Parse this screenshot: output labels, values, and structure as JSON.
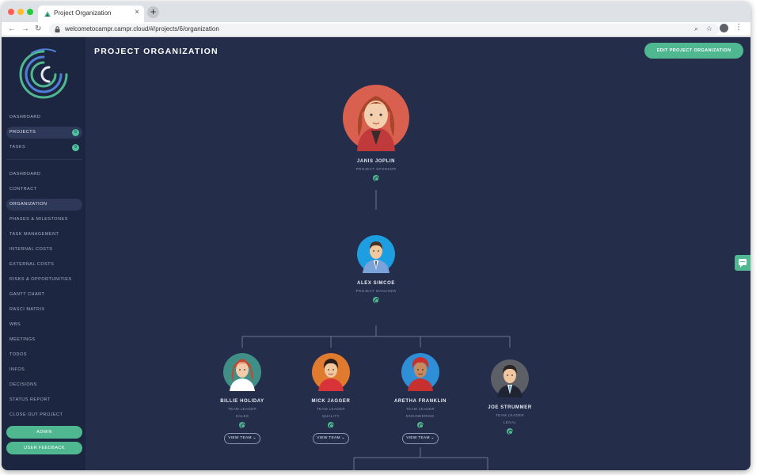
{
  "browser": {
    "tab_title": "Project Organization",
    "tab_close": "×",
    "new_tab": "+",
    "back": "←",
    "forward": "→",
    "reload": "↻",
    "url": "welcometocampr.campr.cloud/#/projects/6/organization",
    "zoom_icon": "⌕",
    "star_icon": "☆",
    "menu_icon": "⋮"
  },
  "sidebar": {
    "top_items": [
      {
        "label": "DASHBOARD",
        "badge": ""
      },
      {
        "label": "PROJECTS",
        "badge": "6",
        "active": true
      },
      {
        "label": "TASKS",
        "badge": "9"
      }
    ],
    "project_items": [
      {
        "label": "DASHBOARD"
      },
      {
        "label": "CONTRACT"
      },
      {
        "label": "ORGANIZATION",
        "active": true
      },
      {
        "label": "PHASES & MILESTONES"
      },
      {
        "label": "TASK MANAGEMENT"
      },
      {
        "label": "INTERNAL COSTS"
      },
      {
        "label": "EXTERNAL COSTS"
      },
      {
        "label": "RISKS & OPPORTUNITIES"
      },
      {
        "label": "GANTT CHART"
      },
      {
        "label": "RASCI MATRIX"
      },
      {
        "label": "WBS"
      },
      {
        "label": "MEETINGS"
      },
      {
        "label": "TODOS"
      },
      {
        "label": "INFOS"
      },
      {
        "label": "DECISIONS"
      },
      {
        "label": "STATUS REPORT"
      },
      {
        "label": "CLOSE OUT PROJECT"
      }
    ],
    "admin_button": "ADMIN",
    "feedback_button": "USER FEEDBACK"
  },
  "page": {
    "title": "PROJECT ORGANIZATION",
    "edit_button": "EDIT PROJECT ORGANIZATION"
  },
  "org": {
    "sponsor": {
      "name": "JANIS JOPLIN",
      "role": "PROJECT SPONSOR"
    },
    "manager": {
      "name": "ALEX SIMCOE",
      "role": "PROJECT MANAGER"
    },
    "leaders": [
      {
        "name": "BILLIE HOLIDAY",
        "role": "TEAM LEADER",
        "dept": "SALES",
        "view_team": "VIEW TEAM ⌄"
      },
      {
        "name": "MICK JAGGER",
        "role": "TEAM LEADER",
        "dept": "QUALITY",
        "view_team": "VIEW TEAM ⌄"
      },
      {
        "name": "ARETHA FRANKLIN",
        "role": "TEAM LEADER",
        "dept": "ENGINEERING",
        "view_team": "VIEW TEAM ⌄"
      },
      {
        "name": "JOE STRUMMER",
        "role": "TEAM LEADER",
        "dept": "LEGAL"
      }
    ]
  },
  "colors": {
    "app_bg": "#242d4a",
    "sidebar_bg": "#1d2640",
    "accent": "#4fb890"
  }
}
